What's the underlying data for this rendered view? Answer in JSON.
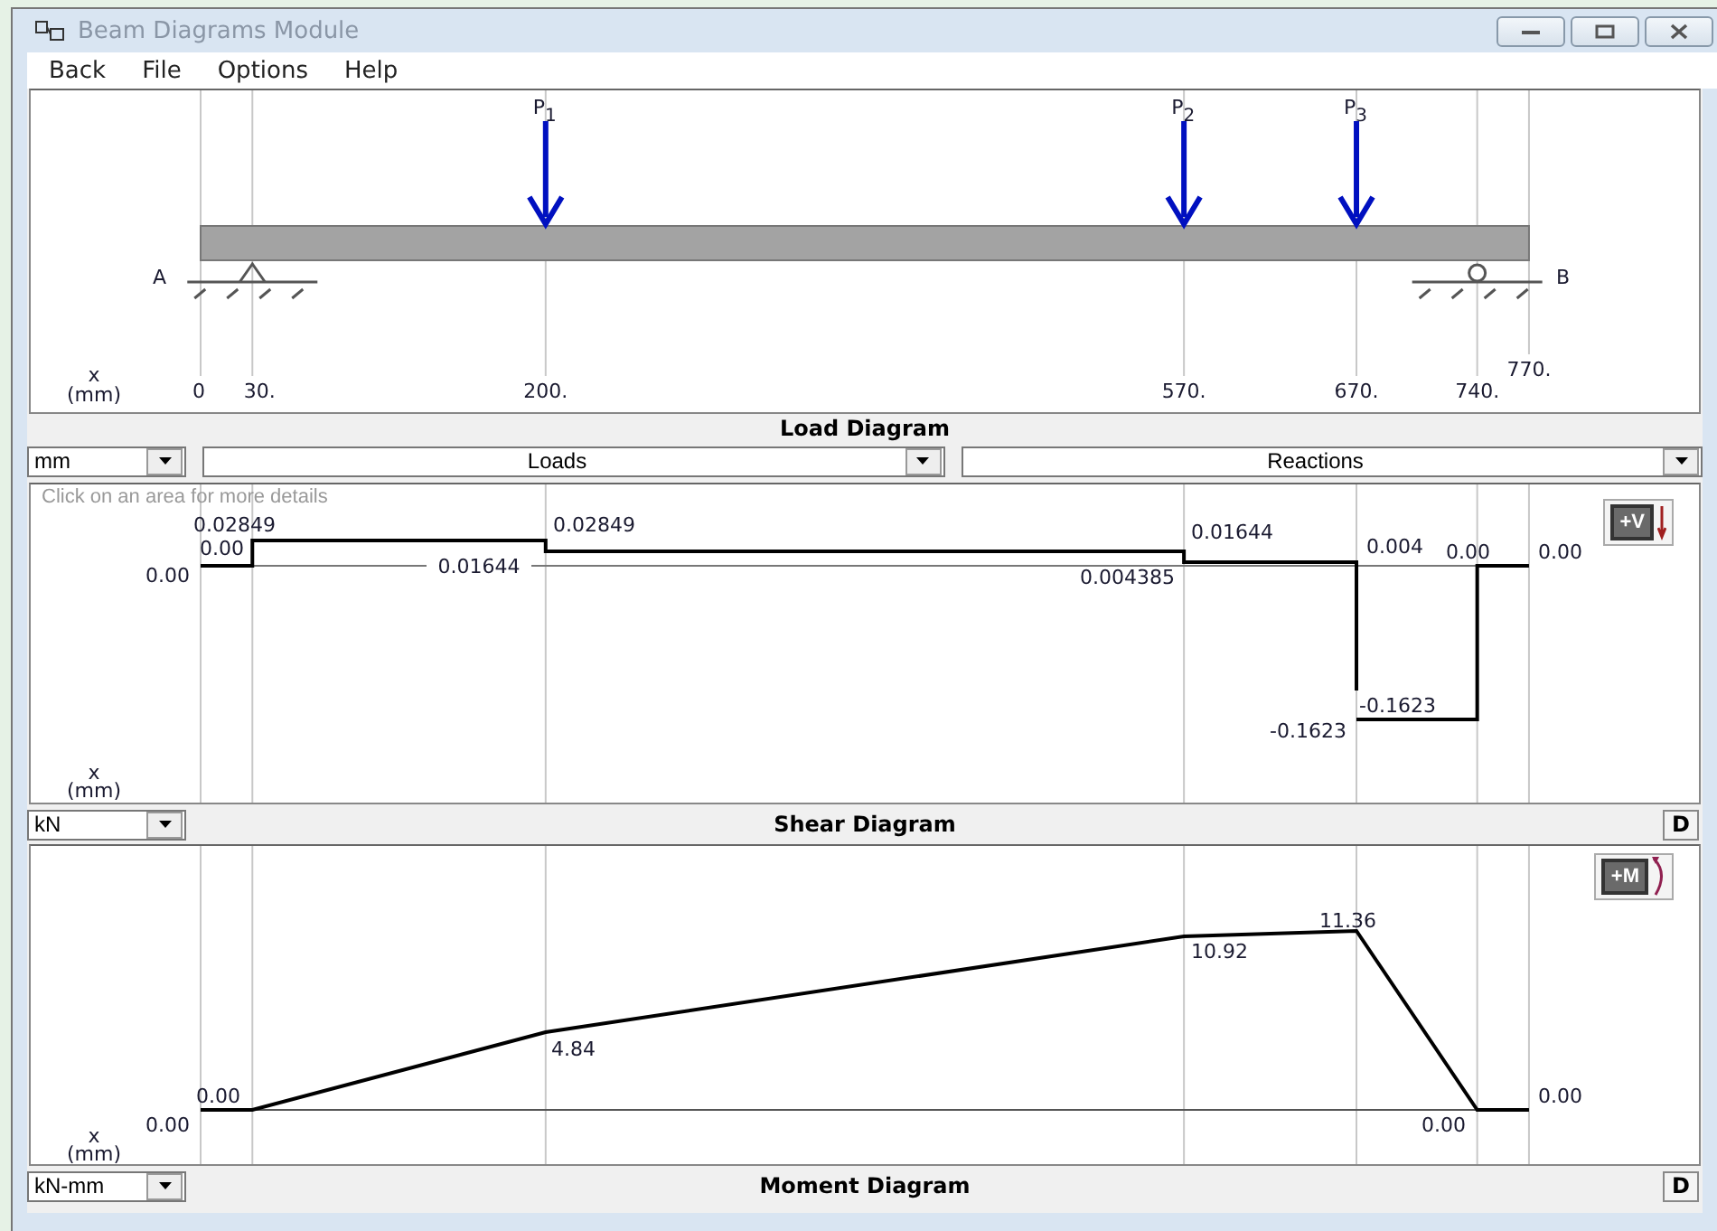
{
  "window": {
    "title": "Beam Diagrams Module"
  },
  "menu": [
    "Back",
    "File",
    "Options",
    "Help"
  ],
  "load_diagram": {
    "title": "Load Diagram",
    "x_label": "x",
    "x_unit": "(mm)",
    "ticks": [
      "0",
      "30.",
      "200.",
      "570.",
      "670.",
      "740.",
      "770."
    ],
    "supports": [
      {
        "label": "A",
        "kind": "pin"
      },
      {
        "label": "B",
        "kind": "roller"
      }
    ],
    "loads": [
      {
        "label": "P",
        "subscript": "1"
      },
      {
        "label": "P",
        "subscript": "2"
      },
      {
        "label": "P",
        "subscript": "3"
      }
    ]
  },
  "selectors": {
    "length_unit": "mm",
    "loads": "Loads",
    "reactions": "Reactions"
  },
  "shear_diagram": {
    "title": "Shear Diagram",
    "hint": "Click on an area for more details",
    "unit": "kN",
    "sign_button": "+V",
    "detail_button": "D",
    "x_label": "x",
    "x_unit": "(mm)",
    "values": [
      "0.02849",
      "0.00",
      "0.00",
      "0.01644",
      "0.02849",
      "0.004385",
      "0.01644",
      "0.004",
      "0.00",
      "0.00",
      "-0.1623",
      "-0.1623"
    ]
  },
  "moment_diagram": {
    "title": "Moment Diagram",
    "unit": "kN-mm",
    "sign_button": "+M",
    "detail_button": "D",
    "x_label": "x",
    "x_unit": "(mm)",
    "values": [
      "0.00",
      "0.00",
      "4.84",
      "10.92",
      "11.36",
      "0.00",
      "0.00"
    ]
  }
}
